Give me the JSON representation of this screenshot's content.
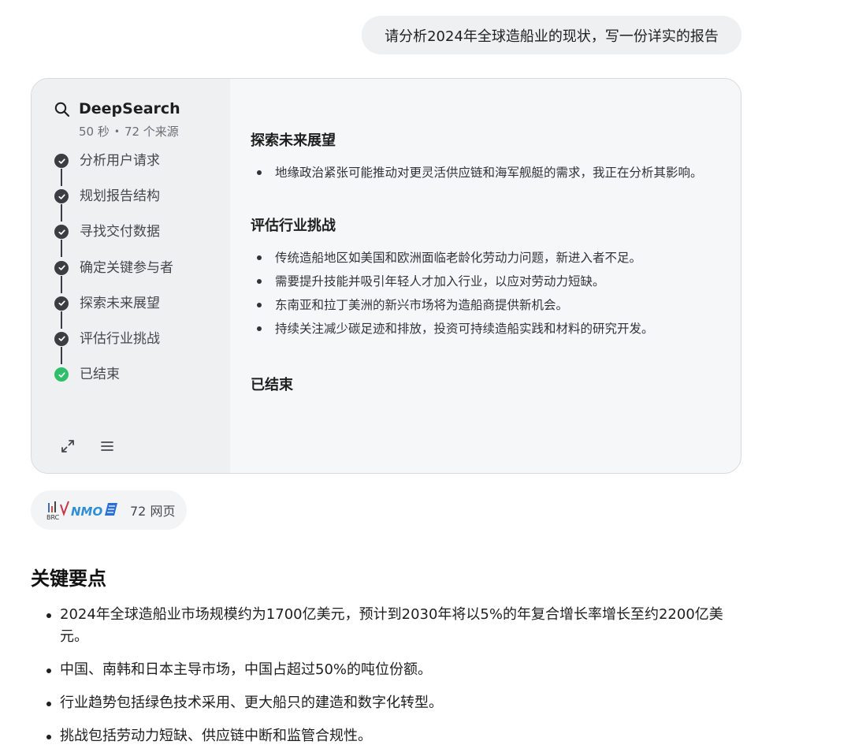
{
  "user_message": "请分析2024年全球造船业的现状，写一份详实的报告",
  "deepsearch": {
    "title": "DeepSearch",
    "duration": "50 秒",
    "sources_label": "72 个来源",
    "steps": [
      {
        "label": "分析用户请求",
        "status": "complete"
      },
      {
        "label": "规划报告结构",
        "status": "complete"
      },
      {
        "label": "寻找交付数据",
        "status": "complete"
      },
      {
        "label": "确定关键参与者",
        "status": "complete"
      },
      {
        "label": "探索未来展望",
        "status": "complete"
      },
      {
        "label": "评估行业挑战",
        "status": "complete"
      },
      {
        "label": "已结束",
        "status": "finished"
      }
    ],
    "sections": [
      {
        "title": "探索未来展望",
        "bullets": [
          "地缘政治紧张可能推动对更灵活供应链和海军舰艇的需求，我正在分析其影响。"
        ]
      },
      {
        "title": "评估行业挑战",
        "bullets": [
          "传统造船地区如美国和欧洲面临老龄化劳动力问题，新进入者不足。",
          "需要提升技能并吸引年轻人才加入行业，以应对劳动力短缺。",
          "东南亚和拉丁美洲的新兴市场将为造船商提供新机会。",
          "持续关注减少碳足迹和排放，投资可持续造船实践和材料的研究开发。"
        ]
      },
      {
        "title": "已结束",
        "bullets": []
      }
    ]
  },
  "sources_pill": {
    "count_label": "72 网页"
  },
  "key_points": {
    "title": "关键要点",
    "items": [
      "2024年全球造船业市场规模约为1700亿美元，预计到2030年将以5%的年复合增长率增长至约2200亿美元。",
      "中国、南韩和日本主导市场，中国占超过50%的吨位份额。",
      "行业趋势包括绿色技术采用、更大船只的建造和数字化转型。",
      "挑战包括劳动力短缺、供应链中断和监管合规性。"
    ]
  },
  "colors": {
    "complete": "#3a3d41",
    "finished": "#2fbf6a",
    "bubble": "#eef0f2"
  }
}
